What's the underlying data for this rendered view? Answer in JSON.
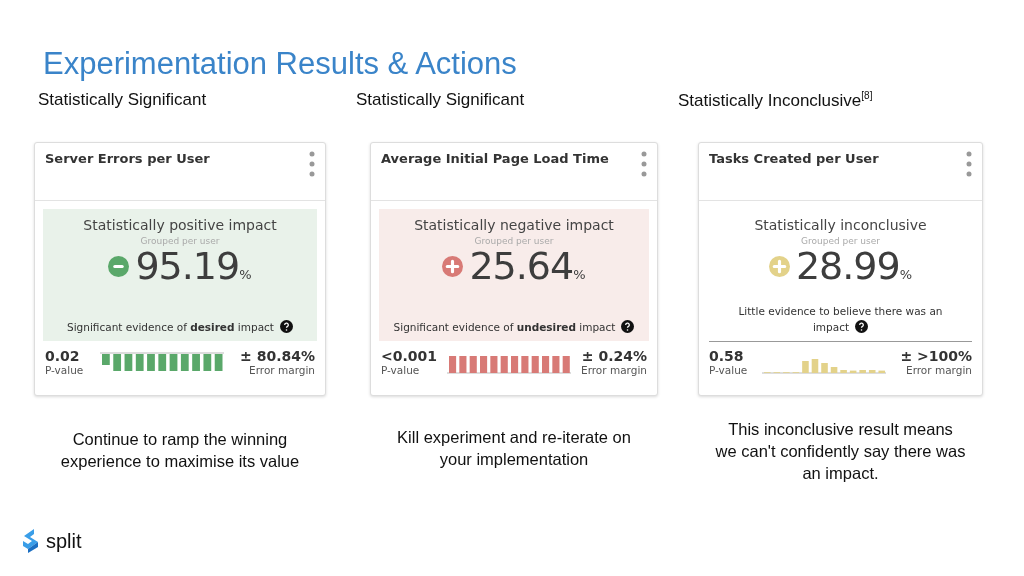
{
  "title": "Experimentation Results & Actions",
  "columns": [
    {
      "heading": "Statistically Significant",
      "kind": "positive",
      "badge": {
        "kind": "minus"
      },
      "card_title": "Server Errors per User",
      "verdict": "Statistically positive impact",
      "grouping": "Grouped per user",
      "value": "95.19",
      "unit": "%",
      "evidence": "Significant evidence of **desired** impact",
      "p_value": "0.02",
      "p_label": "P-value",
      "margin": "± 80.84%",
      "margin_label": "Error margin",
      "caption": "Continue to ramp the winning experience to maximise its value"
    },
    {
      "heading": "Statistically Significant",
      "kind": "negative",
      "badge": {
        "kind": "plus"
      },
      "card_title": "Average Initial Page Load Time",
      "verdict": "Statistically negative impact",
      "grouping": "Grouped per user",
      "value": "25.64",
      "unit": "%",
      "evidence": "Significant evidence of **undesired** impact",
      "p_value": "<0.001",
      "p_label": "P-value",
      "margin": "± 0.24%",
      "margin_label": "Error margin",
      "caption": "Kill experiment and re-iterate on your implementation"
    },
    {
      "heading": "Statistically Inconclusive$^{[8]}$",
      "kind": "inconclusive",
      "badge": {
        "kind": "plus"
      },
      "card_title": "Tasks Created per User",
      "verdict": "Statistically inconclusive",
      "grouping": "Grouped per user",
      "value": "28.99",
      "unit": "%",
      "evidence": "Little evidence to believe there was an impact",
      "p_value": "0.58",
      "p_label": "P-value",
      "margin": "± >100%",
      "margin_label": "Error margin",
      "caption": "This inconclusive result means we can't confidently say there was an impact."
    }
  ],
  "logo": {
    "text": "split"
  }
}
